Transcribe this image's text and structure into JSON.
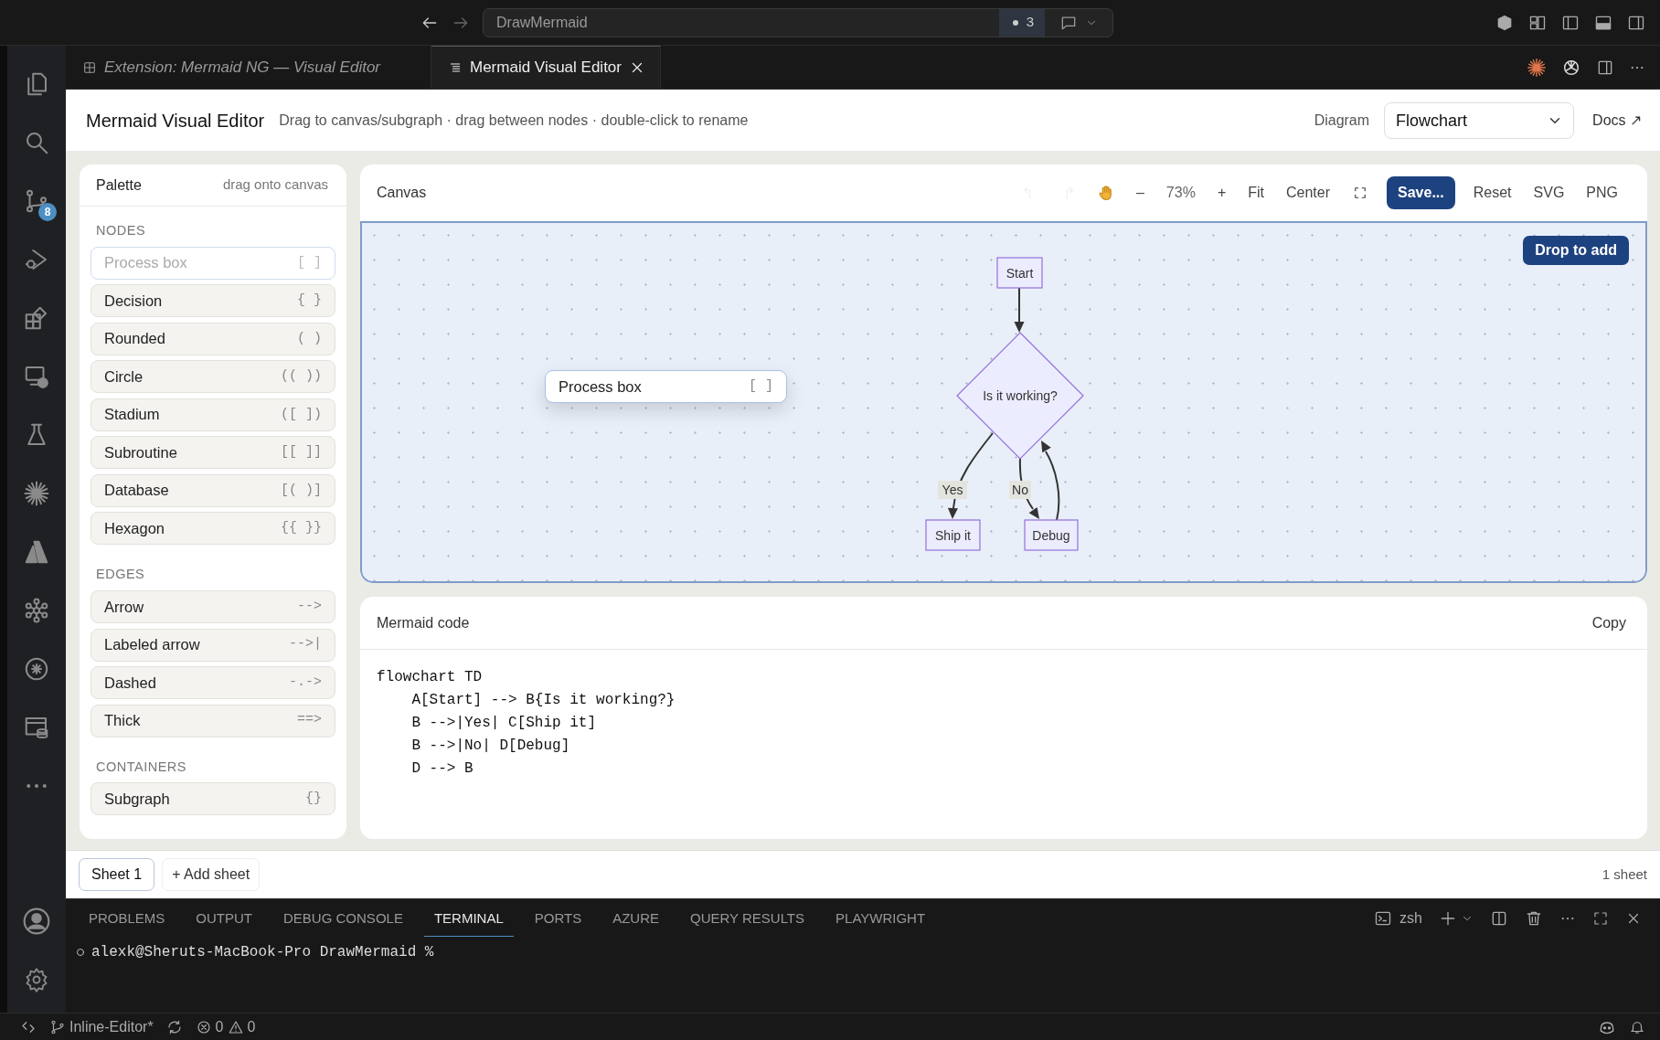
{
  "title_bar": {
    "search": "DrawMermaid",
    "badge": "3"
  },
  "activity_bar": {
    "items": [
      {
        "kind": "files"
      },
      {
        "kind": "search"
      },
      {
        "kind": "branch",
        "badge": "8"
      },
      {
        "kind": "debug"
      },
      {
        "kind": "extensions"
      },
      {
        "kind": "remote"
      },
      {
        "kind": "flask"
      },
      {
        "kind": "burst"
      },
      {
        "kind": "triangle"
      },
      {
        "kind": "nodes"
      },
      {
        "kind": "ring"
      },
      {
        "kind": "database"
      },
      {
        "kind": "more"
      }
    ]
  },
  "editor_tabs": [
    {
      "label": "Extension: Mermaid NG — Visual Editor",
      "selected": false
    },
    {
      "label": "Mermaid Visual Editor",
      "selected": true
    }
  ],
  "header": {
    "title": "Mermaid Visual Editor",
    "hint": "Drag to canvas/subgraph · drag between nodes · double-click to rename",
    "diagram_label": "Diagram",
    "diagram_value": "Flowchart",
    "docs": "Docs ↗"
  },
  "palette": {
    "title": "Palette",
    "hint": "drag onto canvas",
    "sections": [
      {
        "heading": "NODES",
        "items": [
          {
            "label": "Process box",
            "syntax": "[ ]",
            "dragging": true
          },
          {
            "label": "Decision",
            "syntax": "{ }",
            "dragging": false
          },
          {
            "label": "Rounded",
            "syntax": "( )",
            "dragging": false
          },
          {
            "label": "Circle",
            "syntax": "(( ))",
            "dragging": false
          },
          {
            "label": "Stadium",
            "syntax": "([ ])",
            "dragging": false
          },
          {
            "label": "Subroutine",
            "syntax": "[[ ]]",
            "dragging": false
          },
          {
            "label": "Database",
            "syntax": "[( )]",
            "dragging": false
          },
          {
            "label": "Hexagon",
            "syntax": "{{ }}",
            "dragging": false
          }
        ]
      },
      {
        "heading": "EDGES",
        "items": [
          {
            "label": "Arrow",
            "syntax": "-->",
            "dragging": false
          },
          {
            "label": "Labeled arrow",
            "syntax": "-->|",
            "dragging": false
          },
          {
            "label": "Dashed",
            "syntax": "-.->",
            "dragging": false
          },
          {
            "label": "Thick",
            "syntax": "==>",
            "dragging": false
          }
        ]
      },
      {
        "heading": "CONTAINERS",
        "items": [
          {
            "label": "Subgraph",
            "syntax": "{}",
            "dragging": false
          }
        ]
      }
    ]
  },
  "canvas": {
    "title": "Canvas",
    "toolbar": [
      {
        "kind": "undo",
        "disabled": true
      },
      {
        "kind": "redo",
        "disabled": true
      },
      {
        "kind": "hand",
        "disabled": false
      },
      {
        "kind": "text",
        "label": "–",
        "disabled": false
      },
      {
        "kind": "zoom",
        "label": "73%",
        "disabled": false
      },
      {
        "kind": "text",
        "label": "+",
        "disabled": false
      },
      {
        "kind": "text",
        "label": "Fit",
        "disabled": false
      },
      {
        "kind": "text",
        "label": "Center",
        "disabled": false
      },
      {
        "kind": "fullscreen",
        "disabled": false
      },
      {
        "kind": "primary",
        "label": "Save...",
        "disabled": false
      },
      {
        "kind": "text",
        "label": "Reset",
        "disabled": false
      },
      {
        "kind": "text",
        "label": "SVG",
        "disabled": false
      },
      {
        "kind": "text",
        "label": "PNG",
        "disabled": false
      }
    ],
    "drop_hint": "Drop to add",
    "ghost": {
      "label": "Process box",
      "syntax": "[ ]"
    },
    "nodes": [
      {
        "kind": "rect",
        "label": "Start"
      },
      {
        "kind": "diamond",
        "label": "Is it working?"
      },
      {
        "kind": "rect",
        "label": "Ship it"
      },
      {
        "kind": "rect",
        "label": "Debug"
      }
    ],
    "edge_labels": [
      "Yes",
      "No"
    ]
  },
  "code": {
    "title": "Mermaid code",
    "copy": "Copy",
    "lines": [
      "flowchart TD",
      "    A[Start] --> B{Is it working?}",
      "    B -->|Yes| C[Ship it]",
      "    B -->|No| D[Debug]",
      "    D --> B"
    ]
  },
  "sheets": {
    "tabs": [
      {
        "label": "Sheet 1",
        "selected": true
      }
    ],
    "add": "+ Add sheet",
    "count": "1 sheet"
  },
  "panel": {
    "tabs": [
      {
        "label": "PROBLEMS",
        "selected": false
      },
      {
        "label": "OUTPUT",
        "selected": false
      },
      {
        "label": "DEBUG CONSOLE",
        "selected": false
      },
      {
        "label": "TERMINAL",
        "selected": true
      },
      {
        "label": "PORTS",
        "selected": false
      },
      {
        "label": "AZURE",
        "selected": false
      },
      {
        "label": "QUERY RESULTS",
        "selected": false
      },
      {
        "label": "PLAYWRIGHT",
        "selected": false
      }
    ],
    "shell": "zsh",
    "prompt": "alexk@Sheruts-MacBook-Pro DrawMermaid %"
  },
  "status_bar": {
    "branch": "Inline-Editor*",
    "errors": "0",
    "warnings": "0"
  }
}
